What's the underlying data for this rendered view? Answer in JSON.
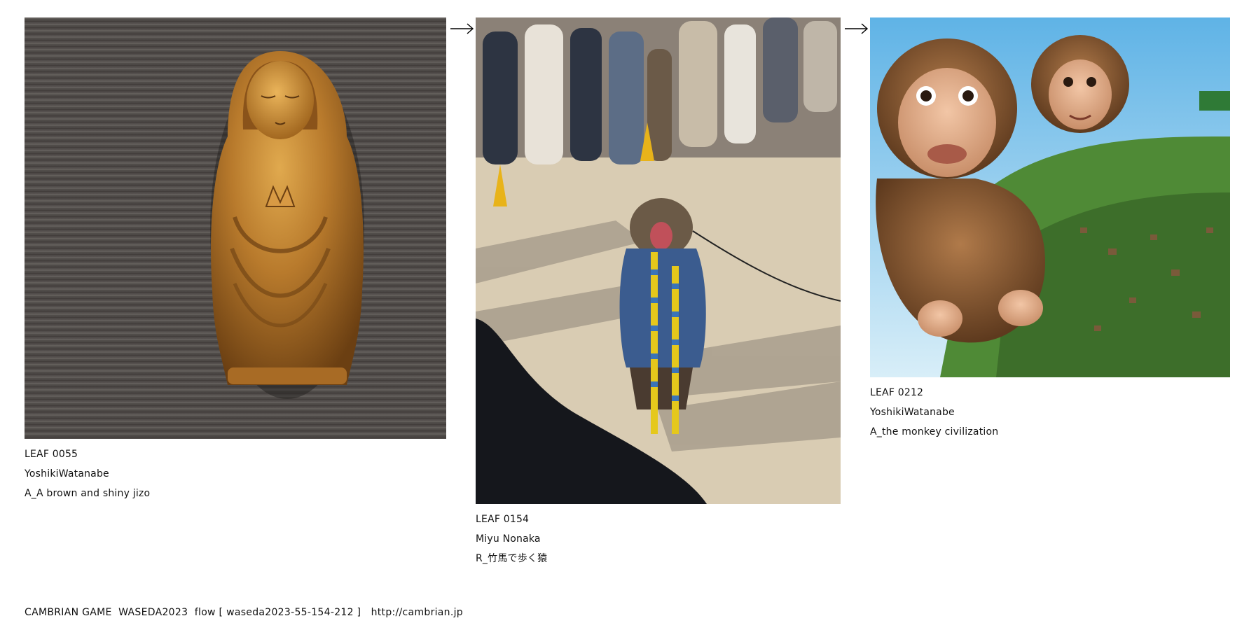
{
  "flow": {
    "leaves": [
      {
        "id": "LEAF 0055",
        "author": "YoshikiWatanabe",
        "title": "A_A brown and shiny jizo"
      },
      {
        "id": "LEAF 0154",
        "author": "Miyu Nonaka",
        "title": "R_竹馬で歩く猿"
      },
      {
        "id": "LEAF 0212",
        "author": "YoshikiWatanabe",
        "title": "A_the monkey civilization"
      }
    ]
  },
  "footer": {
    "text": "CAMBRIAN GAME  WASEDA2023  flow [ waseda2023-55-154-212 ]   http://cambrian.jp"
  }
}
